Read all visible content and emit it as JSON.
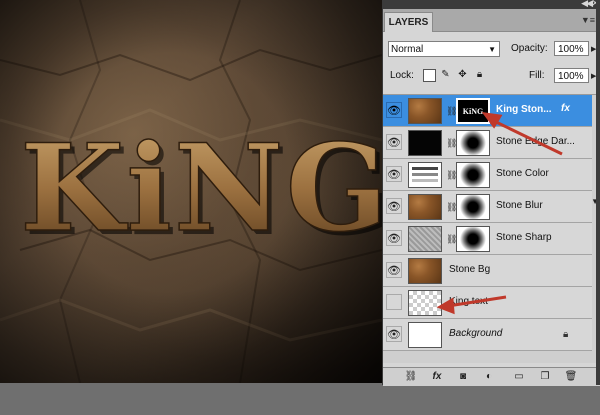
{
  "panel": {
    "tab_label": "LAYERS",
    "blend_mode": "Normal",
    "opacity_label": "Opacity:",
    "opacity_value": "100%",
    "lock_label": "Lock:",
    "fill_label": "Fill:",
    "fill_value": "100%"
  },
  "artwork": {
    "text": "KiNG"
  },
  "layers": [
    {
      "name": "King Ston...",
      "selected": true,
      "visible": true,
      "has_fx": true,
      "thumb": "stone",
      "mask": "king-mask"
    },
    {
      "name": "Stone Edge Dar...",
      "selected": false,
      "visible": true,
      "thumb": "black",
      "mask": "radial"
    },
    {
      "name": "Stone Color",
      "selected": false,
      "visible": true,
      "thumb": "adjustment",
      "mask": "radial"
    },
    {
      "name": "Stone Blur",
      "selected": false,
      "visible": true,
      "thumb": "stone",
      "mask": "radial"
    },
    {
      "name": "Stone Sharp",
      "selected": false,
      "visible": true,
      "thumb": "gray",
      "mask": "radial"
    },
    {
      "name": "Stone Bg",
      "selected": false,
      "visible": true,
      "thumb": "stone"
    },
    {
      "name": "King text",
      "selected": false,
      "visible": false,
      "thumb": "checker"
    },
    {
      "name": "Background",
      "selected": false,
      "visible": true,
      "thumb": "white",
      "locked": true
    }
  ],
  "icons": {
    "fx": "fx",
    "eye": "eye-icon",
    "chain": "link-icon",
    "lock": "lock-icon"
  },
  "colors": {
    "selection": "#3b8ee0",
    "annotation_arrow": "#c0392b"
  }
}
